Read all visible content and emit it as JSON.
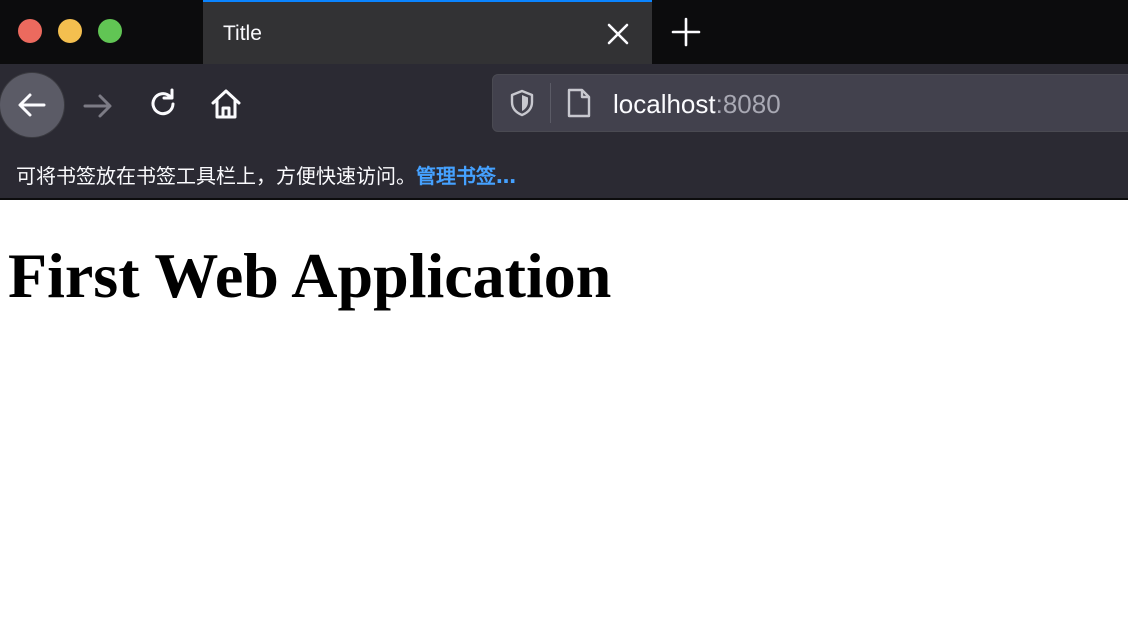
{
  "window": {
    "traffic_lights": [
      "close",
      "minimize",
      "maximize"
    ]
  },
  "tabs": [
    {
      "title": "Title",
      "active": true
    }
  ],
  "toolbar": {
    "url": {
      "host": "localhost",
      "port": ":8080"
    }
  },
  "bookmarks_bar": {
    "hint": "可将书签放在书签工具栏上，方便快速访问。",
    "manage_link": "管理书签…"
  },
  "page": {
    "heading": "First Web Application"
  },
  "colors": {
    "accent": "#0a84ff",
    "link": "#45a1ff",
    "chrome_dark": "#0c0c0d",
    "toolbar": "#2b2a33"
  },
  "icons": [
    "back-arrow-icon",
    "forward-arrow-icon",
    "reload-icon",
    "home-icon",
    "shield-icon",
    "page-icon",
    "close-icon",
    "plus-icon"
  ]
}
